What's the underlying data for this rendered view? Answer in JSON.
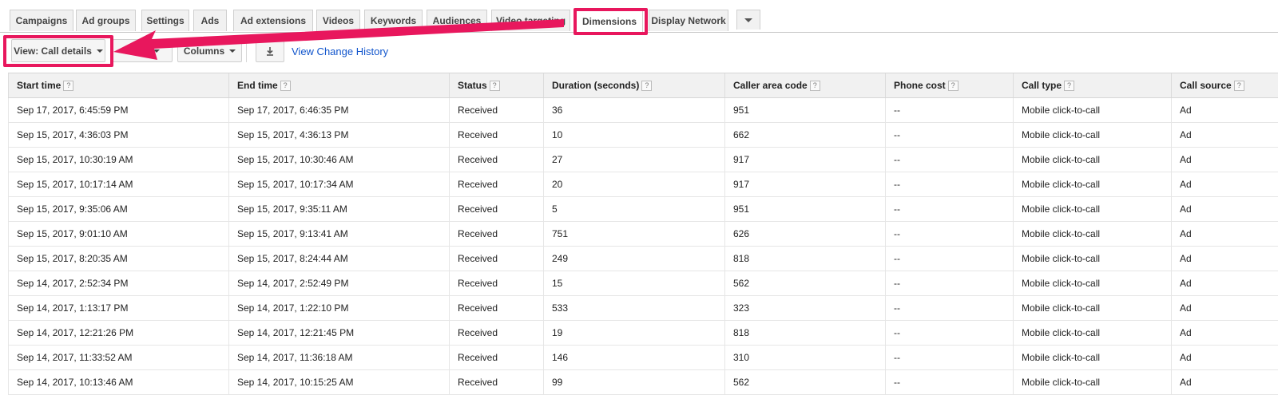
{
  "tabs": [
    {
      "label": "Campaigns"
    },
    {
      "label": "Ad groups"
    },
    {
      "label": "Settings"
    },
    {
      "label": "Ads"
    },
    {
      "label": "Ad extensions"
    },
    {
      "label": "Videos"
    },
    {
      "label": "Keywords"
    },
    {
      "label": "Audiences"
    },
    {
      "label": "Video targeting"
    },
    {
      "label": "Dimensions",
      "active": true
    },
    {
      "label": "Display Network"
    }
  ],
  "toolbar": {
    "view_label": "View: Call details",
    "filter_label": "Filter",
    "columns_label": "Columns",
    "change_history_link": "View Change History"
  },
  "icons": {
    "overflow": "chevron-down-icon",
    "download": "download-icon",
    "help": "question-icon"
  },
  "annotation_color": "#e8175d",
  "table": {
    "help_glyph": "?",
    "columns": [
      "Start time",
      "End time",
      "Status",
      "Duration (seconds)",
      "Caller area code",
      "Phone cost",
      "Call type",
      "Call source"
    ],
    "rows": [
      [
        "Sep 17, 2017, 6:45:59 PM",
        "Sep 17, 2017, 6:46:35 PM",
        "Received",
        "36",
        "951",
        "--",
        "Mobile click-to-call",
        "Ad"
      ],
      [
        "Sep 15, 2017, 4:36:03 PM",
        "Sep 15, 2017, 4:36:13 PM",
        "Received",
        "10",
        "662",
        "--",
        "Mobile click-to-call",
        "Ad"
      ],
      [
        "Sep 15, 2017, 10:30:19 AM",
        "Sep 15, 2017, 10:30:46 AM",
        "Received",
        "27",
        "917",
        "--",
        "Mobile click-to-call",
        "Ad"
      ],
      [
        "Sep 15, 2017, 10:17:14 AM",
        "Sep 15, 2017, 10:17:34 AM",
        "Received",
        "20",
        "917",
        "--",
        "Mobile click-to-call",
        "Ad"
      ],
      [
        "Sep 15, 2017, 9:35:06 AM",
        "Sep 15, 2017, 9:35:11 AM",
        "Received",
        "5",
        "951",
        "--",
        "Mobile click-to-call",
        "Ad"
      ],
      [
        "Sep 15, 2017, 9:01:10 AM",
        "Sep 15, 2017, 9:13:41 AM",
        "Received",
        "751",
        "626",
        "--",
        "Mobile click-to-call",
        "Ad"
      ],
      [
        "Sep 15, 2017, 8:20:35 AM",
        "Sep 15, 2017, 8:24:44 AM",
        "Received",
        "249",
        "818",
        "--",
        "Mobile click-to-call",
        "Ad"
      ],
      [
        "Sep 14, 2017, 2:52:34 PM",
        "Sep 14, 2017, 2:52:49 PM",
        "Received",
        "15",
        "562",
        "--",
        "Mobile click-to-call",
        "Ad"
      ],
      [
        "Sep 14, 2017, 1:13:17 PM",
        "Sep 14, 2017, 1:22:10 PM",
        "Received",
        "533",
        "323",
        "--",
        "Mobile click-to-call",
        "Ad"
      ],
      [
        "Sep 14, 2017, 12:21:26 PM",
        "Sep 14, 2017, 12:21:45 PM",
        "Received",
        "19",
        "818",
        "--",
        "Mobile click-to-call",
        "Ad"
      ],
      [
        "Sep 14, 2017, 11:33:52 AM",
        "Sep 14, 2017, 11:36:18 AM",
        "Received",
        "146",
        "310",
        "--",
        "Mobile click-to-call",
        "Ad"
      ],
      [
        "Sep 14, 2017, 10:13:46 AM",
        "Sep 14, 2017, 10:15:25 AM",
        "Received",
        "99",
        "562",
        "--",
        "Mobile click-to-call",
        "Ad"
      ]
    ]
  }
}
